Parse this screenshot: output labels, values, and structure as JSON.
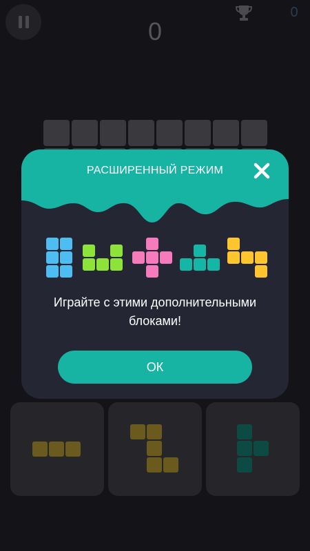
{
  "hud": {
    "score": "0",
    "best_score": "0",
    "pause_icon": "pause-icon",
    "trophy_icon": "trophy-icon"
  },
  "popup": {
    "title": "РАСШИРЕННЫЙ РЕЖИМ",
    "message_line1": "Играйте с этими дополнительными",
    "message_line2": "блоками!",
    "ok_label": "ОК",
    "close_icon": "close-icon",
    "header_color": "#17b3a3",
    "new_pieces": [
      {
        "name": "blue-2x3-block",
        "color": "#4dbdf2"
      },
      {
        "name": "green-u-block",
        "color": "#8ee33a"
      },
      {
        "name": "pink-plus-block",
        "color": "#f57bbd"
      },
      {
        "name": "teal-t-block",
        "color": "#16b6a6"
      },
      {
        "name": "yellow-z-block",
        "color": "#fec52e"
      }
    ]
  },
  "tray_pieces": [
    {
      "name": "line-3-block",
      "color": "#6b5a1e"
    },
    {
      "name": "z-shape-block",
      "color": "#6b5a1e"
    },
    {
      "name": "t-shape-block",
      "color": "#0d4a44"
    }
  ]
}
